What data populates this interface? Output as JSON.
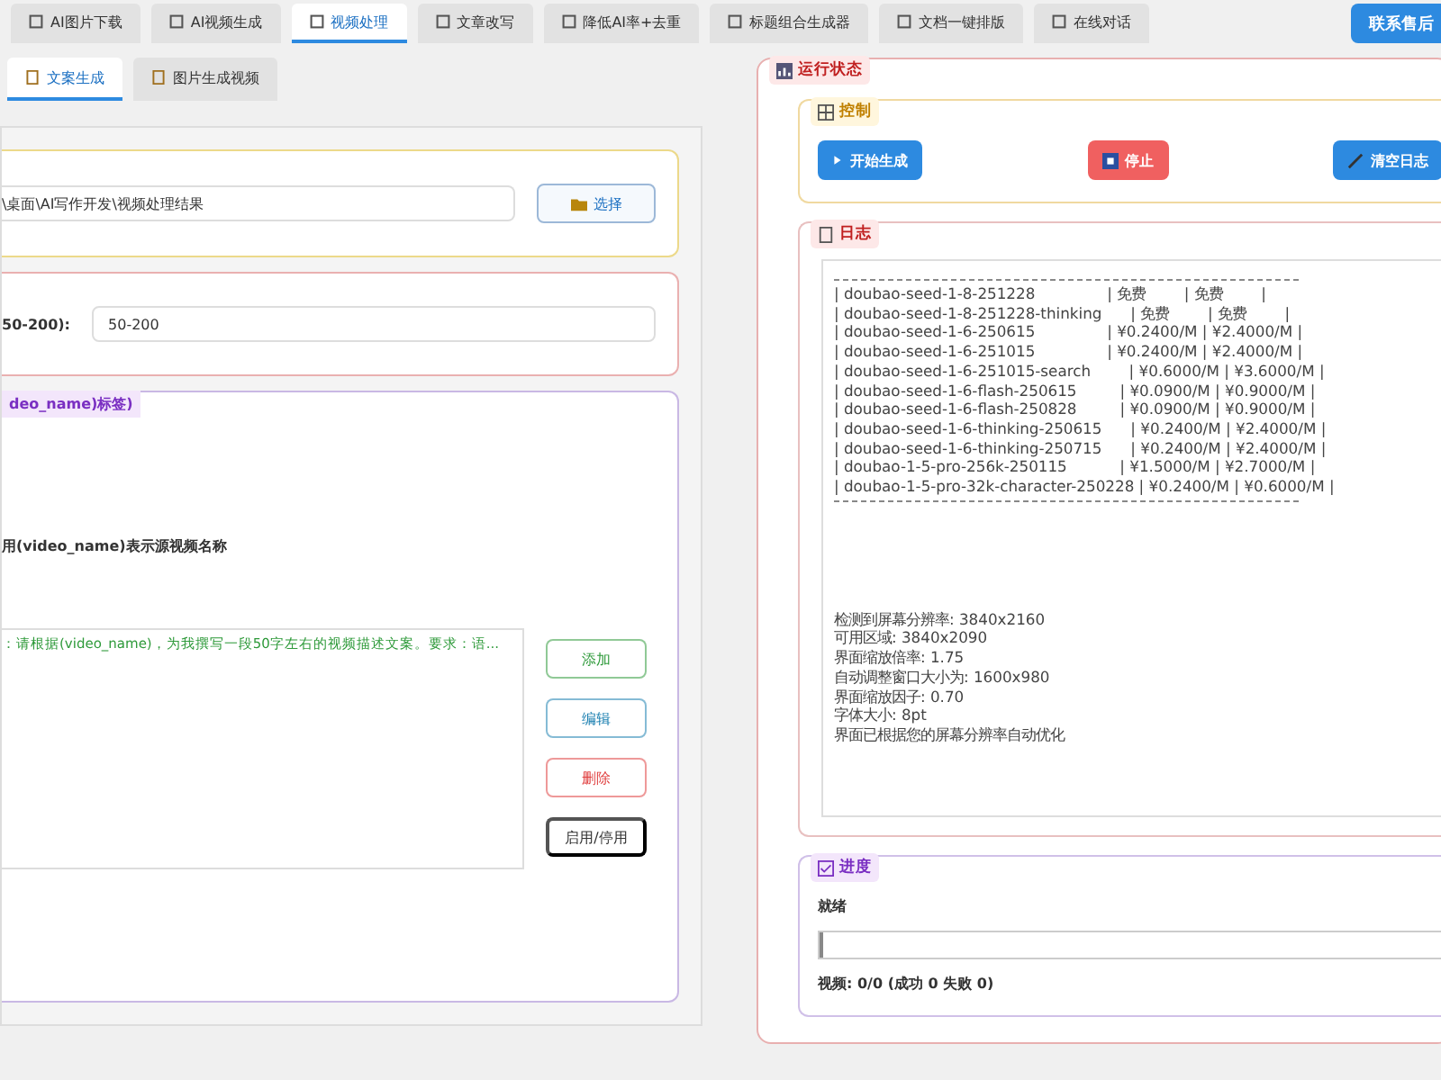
{
  "main_tabs": [
    {
      "label": "AI图片下载",
      "selected": false
    },
    {
      "label": "AI视频生成",
      "selected": false
    },
    {
      "label": "视频处理",
      "selected": true
    },
    {
      "label": "文章改写",
      "selected": false
    },
    {
      "label": "降低AI率+去重",
      "selected": false
    },
    {
      "label": "标题组合生成器",
      "selected": false
    },
    {
      "label": "文档一键排版",
      "selected": false
    },
    {
      "label": "在线对话",
      "selected": false
    }
  ],
  "support_button": "联系售后",
  "sub_tabs": [
    {
      "label": "文案生成",
      "selected": true
    },
    {
      "label": "图片生成视频",
      "selected": false
    }
  ],
  "output": {
    "path": "\\桌面\\AI写作开发\\视频处理结果",
    "button": "选择"
  },
  "word_count": {
    "label": "50-200):",
    "value": "50-200"
  },
  "prompts": {
    "title": "deo_name)标签)",
    "hint": "用(video_name)表示源视频名称",
    "items": [
      {
        "text": "：请根据(video_name)，为我撰写一段50字左右的视频描述文案。要求：语...",
        "enabled": true
      }
    ],
    "buttons": [
      {
        "label": "添加",
        "kind": "add"
      },
      {
        "label": "编辑",
        "kind": "edit"
      },
      {
        "label": "删除",
        "kind": "delete"
      },
      {
        "label": "启用/停用",
        "kind": "toggle"
      }
    ]
  },
  "status": {
    "title": "运行状态",
    "control": {
      "title": "控制",
      "buttons": [
        {
          "label": "开始生成",
          "kind": "start"
        },
        {
          "label": "停止",
          "kind": "stop"
        },
        {
          "label": "清空日志",
          "kind": "clear"
        }
      ]
    },
    "log": {
      "title": "日志",
      "table_lines": [
        "| doubao-seed-1-8-251228               | 免费        | 免费        |",
        "| doubao-seed-1-8-251228-thinking      | 免费        | 免费        |",
        "| doubao-seed-1-6-250615               | ¥0.2400/M | ¥2.4000/M |",
        "| doubao-seed-1-6-251015               | ¥0.2400/M | ¥2.4000/M |",
        "| doubao-seed-1-6-251015-search        | ¥0.6000/M | ¥3.6000/M |",
        "| doubao-seed-1-6-flash-250615         | ¥0.0900/M | ¥0.9000/M |",
        "| doubao-seed-1-6-flash-250828         | ¥0.0900/M | ¥0.9000/M |",
        "| doubao-seed-1-6-thinking-250615      | ¥0.2400/M | ¥2.4000/M |",
        "| doubao-seed-1-6-thinking-250715      | ¥0.2400/M | ¥2.4000/M |",
        "| doubao-1-5-pro-256k-250115           | ¥1.5000/M | ¥2.7000/M |",
        "| doubao-1-5-pro-32k-character-250228 | ¥0.2400/M | ¥0.6000/M |"
      ],
      "lines": [
        "检测到屏幕分辨率: 3840x2160",
        "可用区域: 3840x2090",
        "界面缩放倍率: 1.75",
        "自动调整窗口大小为: 1600x980",
        "界面缩放因子: 0.70",
        "字体大小: 8pt",
        "界面已根据您的屏幕分辨率自动优化"
      ]
    },
    "progress": {
      "title": "进度",
      "state": "就绪",
      "level": 0,
      "summary": "视频: 0/0 (成功 0 失败 0)"
    }
  }
}
